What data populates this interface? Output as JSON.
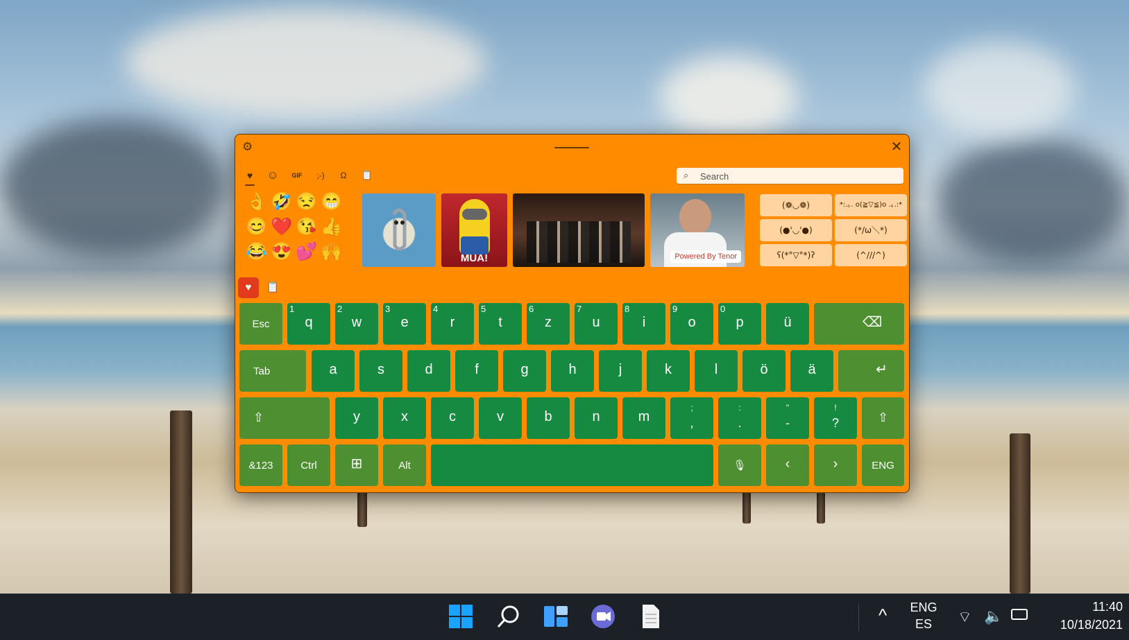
{
  "keyboard": {
    "categories": [
      {
        "name": "favorites-icon",
        "glyph": "♥"
      },
      {
        "name": "emoji-icon",
        "glyph": "☺"
      },
      {
        "name": "gif-icon",
        "glyph": "GIF"
      },
      {
        "name": "kaomoji-icon",
        "glyph": ";-)"
      },
      {
        "name": "symbols-icon",
        "glyph": "Ω"
      },
      {
        "name": "clipboard-icon",
        "glyph": "📋"
      }
    ],
    "search_placeholder": "Search",
    "emojis": [
      "👌",
      "🤣",
      "😒",
      "😁",
      "😊",
      "❤️",
      "😘",
      "👍",
      "😂",
      "😍",
      "💕",
      "🙌"
    ],
    "gif_badge": "Powered By Tenor",
    "gif_1_caption": "MUA!",
    "kaomoji": [
      "(❁◡❁)",
      "*:.｡. o(≧▽≦)o .｡.:*",
      "(●'◡'●)",
      "(*/ω＼*)",
      "ʕ(*°▽°*)ʔ",
      "(^///^)"
    ],
    "row1": [
      {
        "label": "Esc",
        "num": ""
      },
      {
        "label": "q",
        "num": "1"
      },
      {
        "label": "w",
        "num": "2"
      },
      {
        "label": "e",
        "num": "3"
      },
      {
        "label": "r",
        "num": "4"
      },
      {
        "label": "t",
        "num": "5"
      },
      {
        "label": "z",
        "num": "6"
      },
      {
        "label": "u",
        "num": "7"
      },
      {
        "label": "i",
        "num": "8"
      },
      {
        "label": "o",
        "num": "9"
      },
      {
        "label": "p",
        "num": "0"
      },
      {
        "label": "ü",
        "num": ""
      },
      {
        "label": "⌫",
        "num": ""
      }
    ],
    "row2": [
      "Tab",
      "a",
      "s",
      "d",
      "f",
      "g",
      "h",
      "j",
      "k",
      "l",
      "ö",
      "ä",
      "↵"
    ],
    "row3": [
      {
        "top": "",
        "bot": "⇧"
      },
      {
        "top": "",
        "bot": "y"
      },
      {
        "top": "",
        "bot": "x"
      },
      {
        "top": "",
        "bot": "c"
      },
      {
        "top": "",
        "bot": "v"
      },
      {
        "top": "",
        "bot": "b"
      },
      {
        "top": "",
        "bot": "n"
      },
      {
        "top": "",
        "bot": "m"
      },
      {
        "top": ";",
        "bot": ","
      },
      {
        "top": ":",
        "bot": "."
      },
      {
        "top": "\"",
        "bot": "-"
      },
      {
        "top": "!",
        "bot": "?"
      },
      {
        "top": "",
        "bot": "⇧"
      }
    ],
    "row4": [
      "&123",
      "Ctrl",
      "⊞",
      "Alt",
      "",
      "🎙",
      "‹",
      "›",
      "ENG"
    ]
  },
  "taskbar": {
    "lang_top": "ENG",
    "lang_bottom": "ES",
    "time": "11:40",
    "date": "10/18/2021"
  },
  "colors": {
    "panel": "#ff8c00",
    "key": "#168a41",
    "key_dark": "#4e8f32",
    "active_tool": "#e23a1d"
  }
}
